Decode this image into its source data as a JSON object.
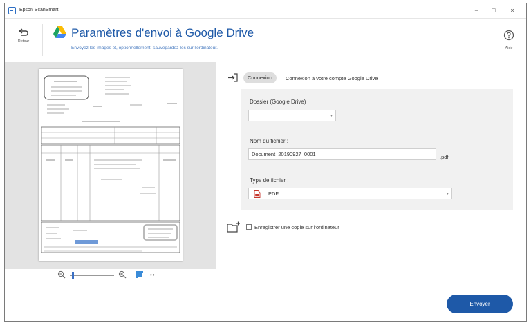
{
  "window": {
    "title": "Epson ScanSmart",
    "minimize_label": "−",
    "maximize_label": "□",
    "close_label": "×"
  },
  "header": {
    "back_label": "Retour",
    "title": "Paramètres d'envoi à Google Drive",
    "subtitle": "Envoyez les images et, optionnellement, sauvegardez-les sur l'ordinateur.",
    "help_label": "Aide"
  },
  "preview": {
    "zoom_out_icon": "zoom-out-icon",
    "zoom_in_icon": "zoom-in-icon",
    "fit_icon": "fit-page-icon",
    "more_label": "••"
  },
  "account": {
    "login_button": "Connexion",
    "login_text": "Connexion à votre compte Google Drive"
  },
  "folder": {
    "label": "Dossier (Google Drive)",
    "value": ""
  },
  "filename": {
    "label": "Nom du fichier :",
    "value": "Document_20190927_0001",
    "extension": ".pdf"
  },
  "filetype": {
    "label": "Type de fichier :",
    "value": "PDF"
  },
  "save_copy": {
    "label": "Enregistrer une copie sur l'ordinateur",
    "checked": false
  },
  "footer": {
    "send_button": "Envoyer"
  },
  "colors": {
    "accent": "#1e59a8",
    "title": "#1f5aa8"
  }
}
